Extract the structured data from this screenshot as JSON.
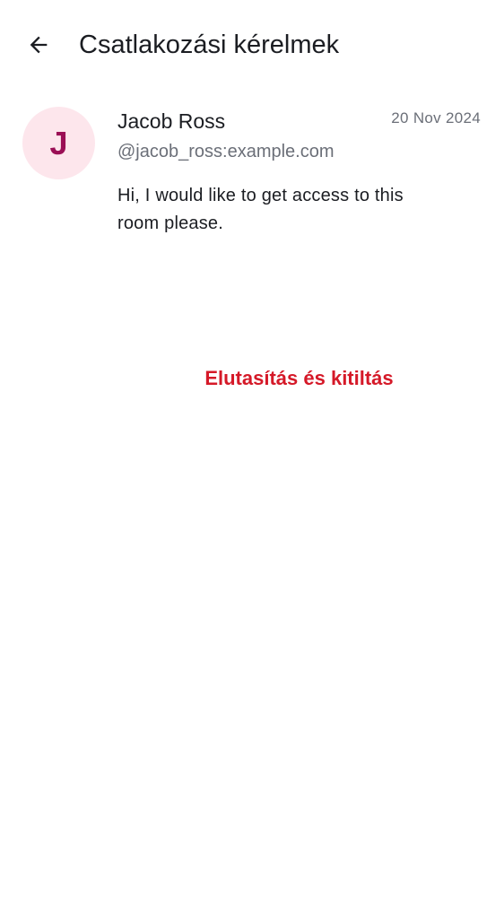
{
  "header": {
    "back_icon": "arrow-left-icon",
    "title": "Csatlakozási kérelmek"
  },
  "request": {
    "avatar_initial": "J",
    "display_name": "Jacob Ross",
    "user_id": "@jacob_ross:example.com",
    "date": "20 Nov 2024",
    "message": "Hi, I would like to get access to this room please.",
    "decline_label": "Elutasítás és kitiltás"
  },
  "colors": {
    "avatar_background": "#fde6ec",
    "avatar_text": "#9b0f55",
    "decline_text": "#d51928",
    "secondary_text": "#6b6f78",
    "primary_text": "#1b1d22"
  }
}
